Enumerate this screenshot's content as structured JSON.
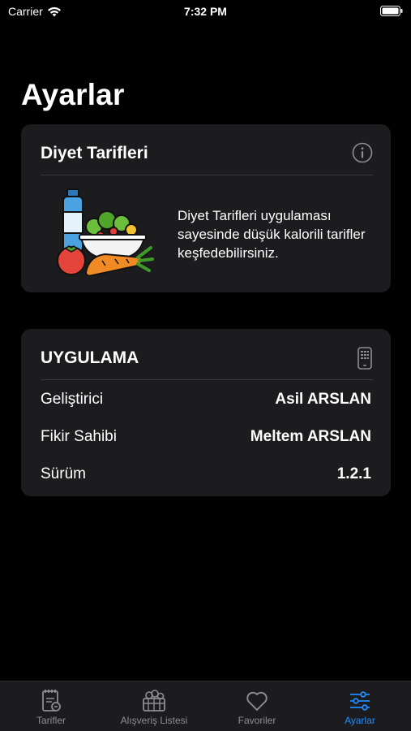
{
  "status_bar": {
    "carrier": "Carrier",
    "time": "7:32 PM"
  },
  "page": {
    "title": "Ayarlar"
  },
  "diet_card": {
    "title": "Diyet Tarifleri",
    "description": "Diyet Tarifleri uygulaması sayesinde düşük kalorili tarifler keşfedebilirsiniz.",
    "icon": "info-icon"
  },
  "app_card": {
    "title": "UYGULAMA",
    "icon": "phone-icon",
    "rows": [
      {
        "label": "Geliştirici",
        "value": "Asil ARSLAN"
      },
      {
        "label": "Fikir Sahibi",
        "value": "Meltem ARSLAN"
      },
      {
        "label": "Sürüm",
        "value": "1.2.1"
      }
    ]
  },
  "tab_bar": {
    "tabs": [
      {
        "label": "Tarifler",
        "icon": "recipe-book-icon",
        "active": false
      },
      {
        "label": "Alışveriş Listesi",
        "icon": "grocery-basket-icon",
        "active": false
      },
      {
        "label": "Favoriler",
        "icon": "heart-icon",
        "active": false
      },
      {
        "label": "Ayarlar",
        "icon": "sliders-icon",
        "active": true
      }
    ]
  },
  "colors": {
    "background": "#000000",
    "card": "#1c1c1e",
    "accent": "#1e8bff",
    "inactive_tab": "#8e8e93"
  }
}
